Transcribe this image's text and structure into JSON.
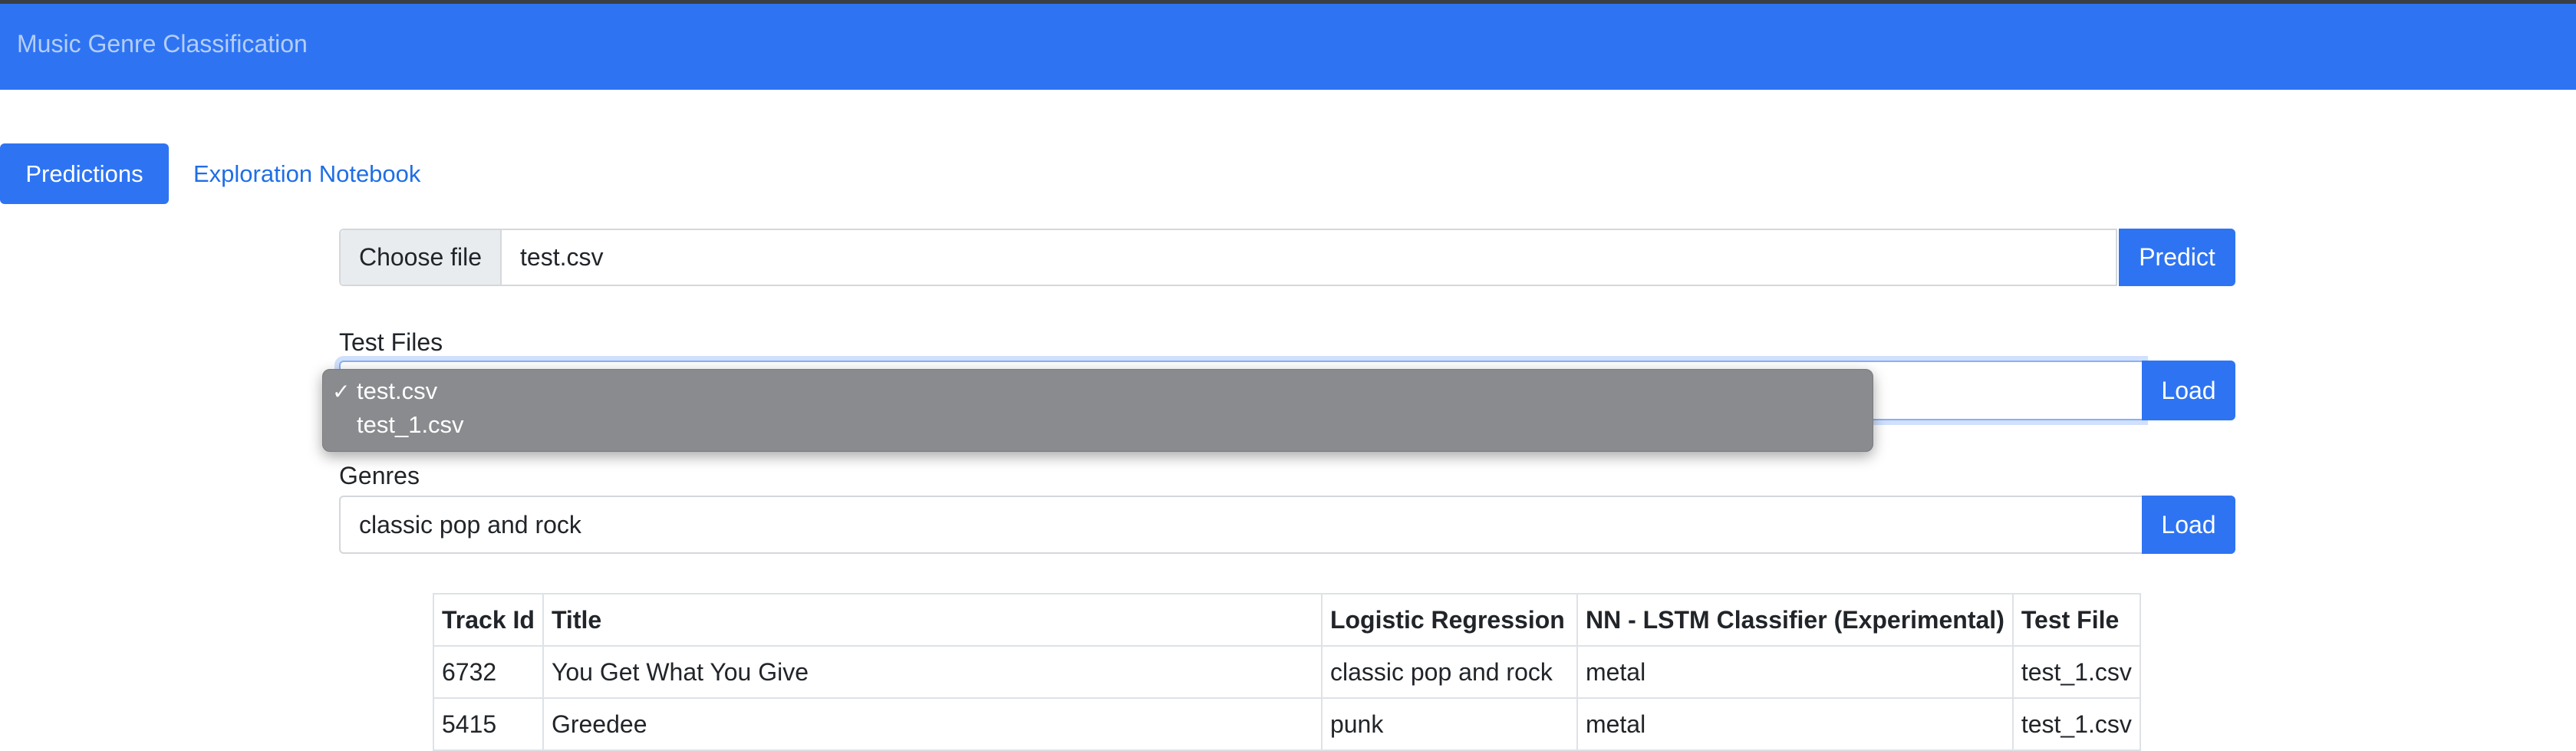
{
  "navbar": {
    "brand": "Music Genre Classification"
  },
  "tabs": [
    {
      "label": "Predictions",
      "active": true
    },
    {
      "label": "Exploration Notebook",
      "active": false
    }
  ],
  "upload": {
    "choose_file_label": "Choose file",
    "file_name": "test.csv",
    "predict_label": "Predict"
  },
  "test_files": {
    "label": "Test Files",
    "options": [
      "test.csv",
      "test_1.csv"
    ],
    "selected": "test.csv",
    "load_label": "Load"
  },
  "genres": {
    "label": "Genres",
    "value": "classic pop and rock",
    "load_label": "Load"
  },
  "table": {
    "headers": [
      "Track Id",
      "Title",
      "Logistic Regression",
      "NN - LSTM Classifier (Experimental)",
      "Test File"
    ],
    "rows": [
      [
        "6732",
        "You Get What You Give",
        "classic pop and rock",
        "metal",
        "test_1.csv"
      ],
      [
        "5415",
        "Greedee",
        "punk",
        "metal",
        "test_1.csv"
      ]
    ]
  },
  "colors": {
    "primary": "#2e74f2",
    "dropdown_bg": "#8a8b8e"
  }
}
